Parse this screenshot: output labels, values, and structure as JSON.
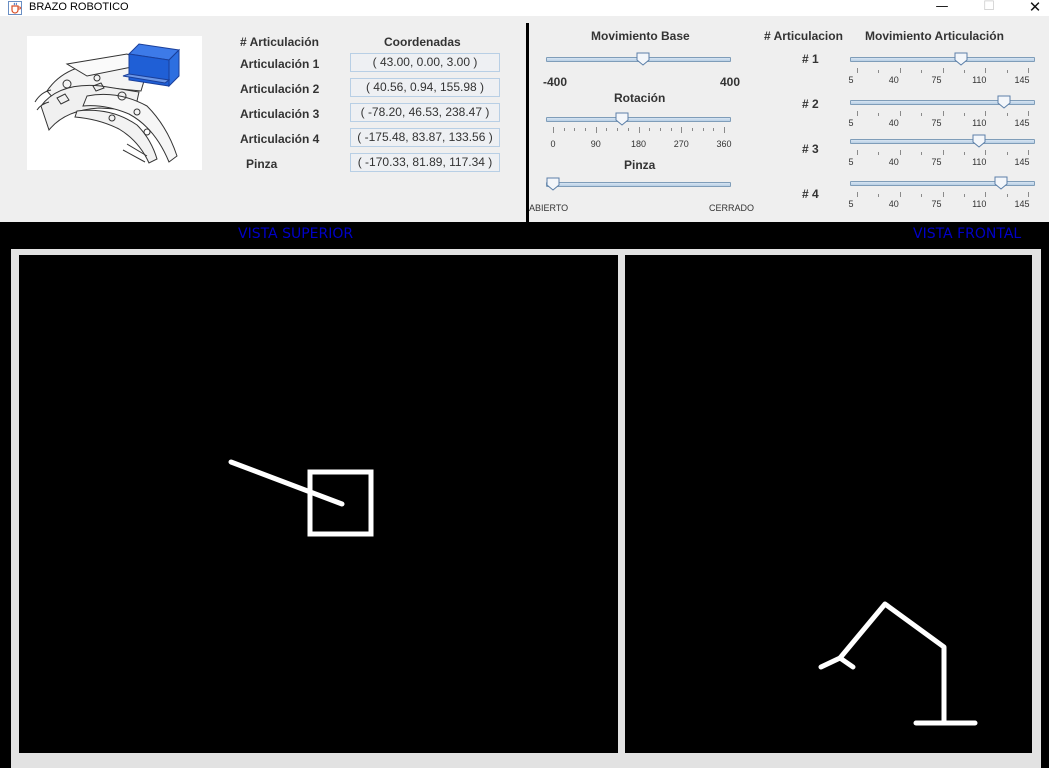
{
  "window": {
    "title": "BRAZO ROBOTICO",
    "minimize_glyph": "—",
    "maximize_glyph": "☐",
    "close_glyph": "✕",
    "icon": "java-cup-icon"
  },
  "table": {
    "col_articulacion": "# Articulación",
    "col_coordenadas": "Coordenadas",
    "rows": [
      {
        "label": "Articulación 1",
        "value": "( 43.00, 0.00, 3.00 )"
      },
      {
        "label": "Articulación 2",
        "value": "( 40.56, 0.94, 155.98 )"
      },
      {
        "label": "Articulación 3",
        "value": "( -78.20, 46.53, 238.47 )"
      },
      {
        "label": "Articulación 4",
        "value": "( -175.48, 83.87, 133.56 )"
      },
      {
        "label": "Pinza",
        "value": "( -170.33, 81.89, 117.34 )"
      }
    ]
  },
  "controls": {
    "base": {
      "title": "Movimiento Base",
      "min_label": "-400",
      "max_label": "400",
      "value": 20
    },
    "rotacion": {
      "title": "Rotación",
      "ticks": [
        "0",
        "90",
        "180",
        "270",
        "360"
      ],
      "value": 145
    },
    "pinza": {
      "title": "Pinza",
      "open_label": "ABIERTO",
      "closed_label": "CERRADO",
      "value": 0
    }
  },
  "joints": {
    "col_articulacion": "# Articulacion",
    "col_movimiento": "Movimiento Articulación",
    "ticks": [
      "5",
      "40",
      "75",
      "110",
      "145"
    ],
    "items": [
      {
        "label": "# 1",
        "value": 90
      },
      {
        "label": "# 2",
        "value": 125
      },
      {
        "label": "# 3",
        "value": 105
      },
      {
        "label": "# 4",
        "value": 123
      }
    ]
  },
  "views": {
    "top_title": "VISTA SUPERIOR",
    "front_title": "VISTA FRONTAL"
  },
  "colors": {
    "view_title": "#0000c8",
    "canvas_bg": "#000000",
    "drawing": "#ffffff",
    "arm_blue": "#1f5fd6"
  }
}
